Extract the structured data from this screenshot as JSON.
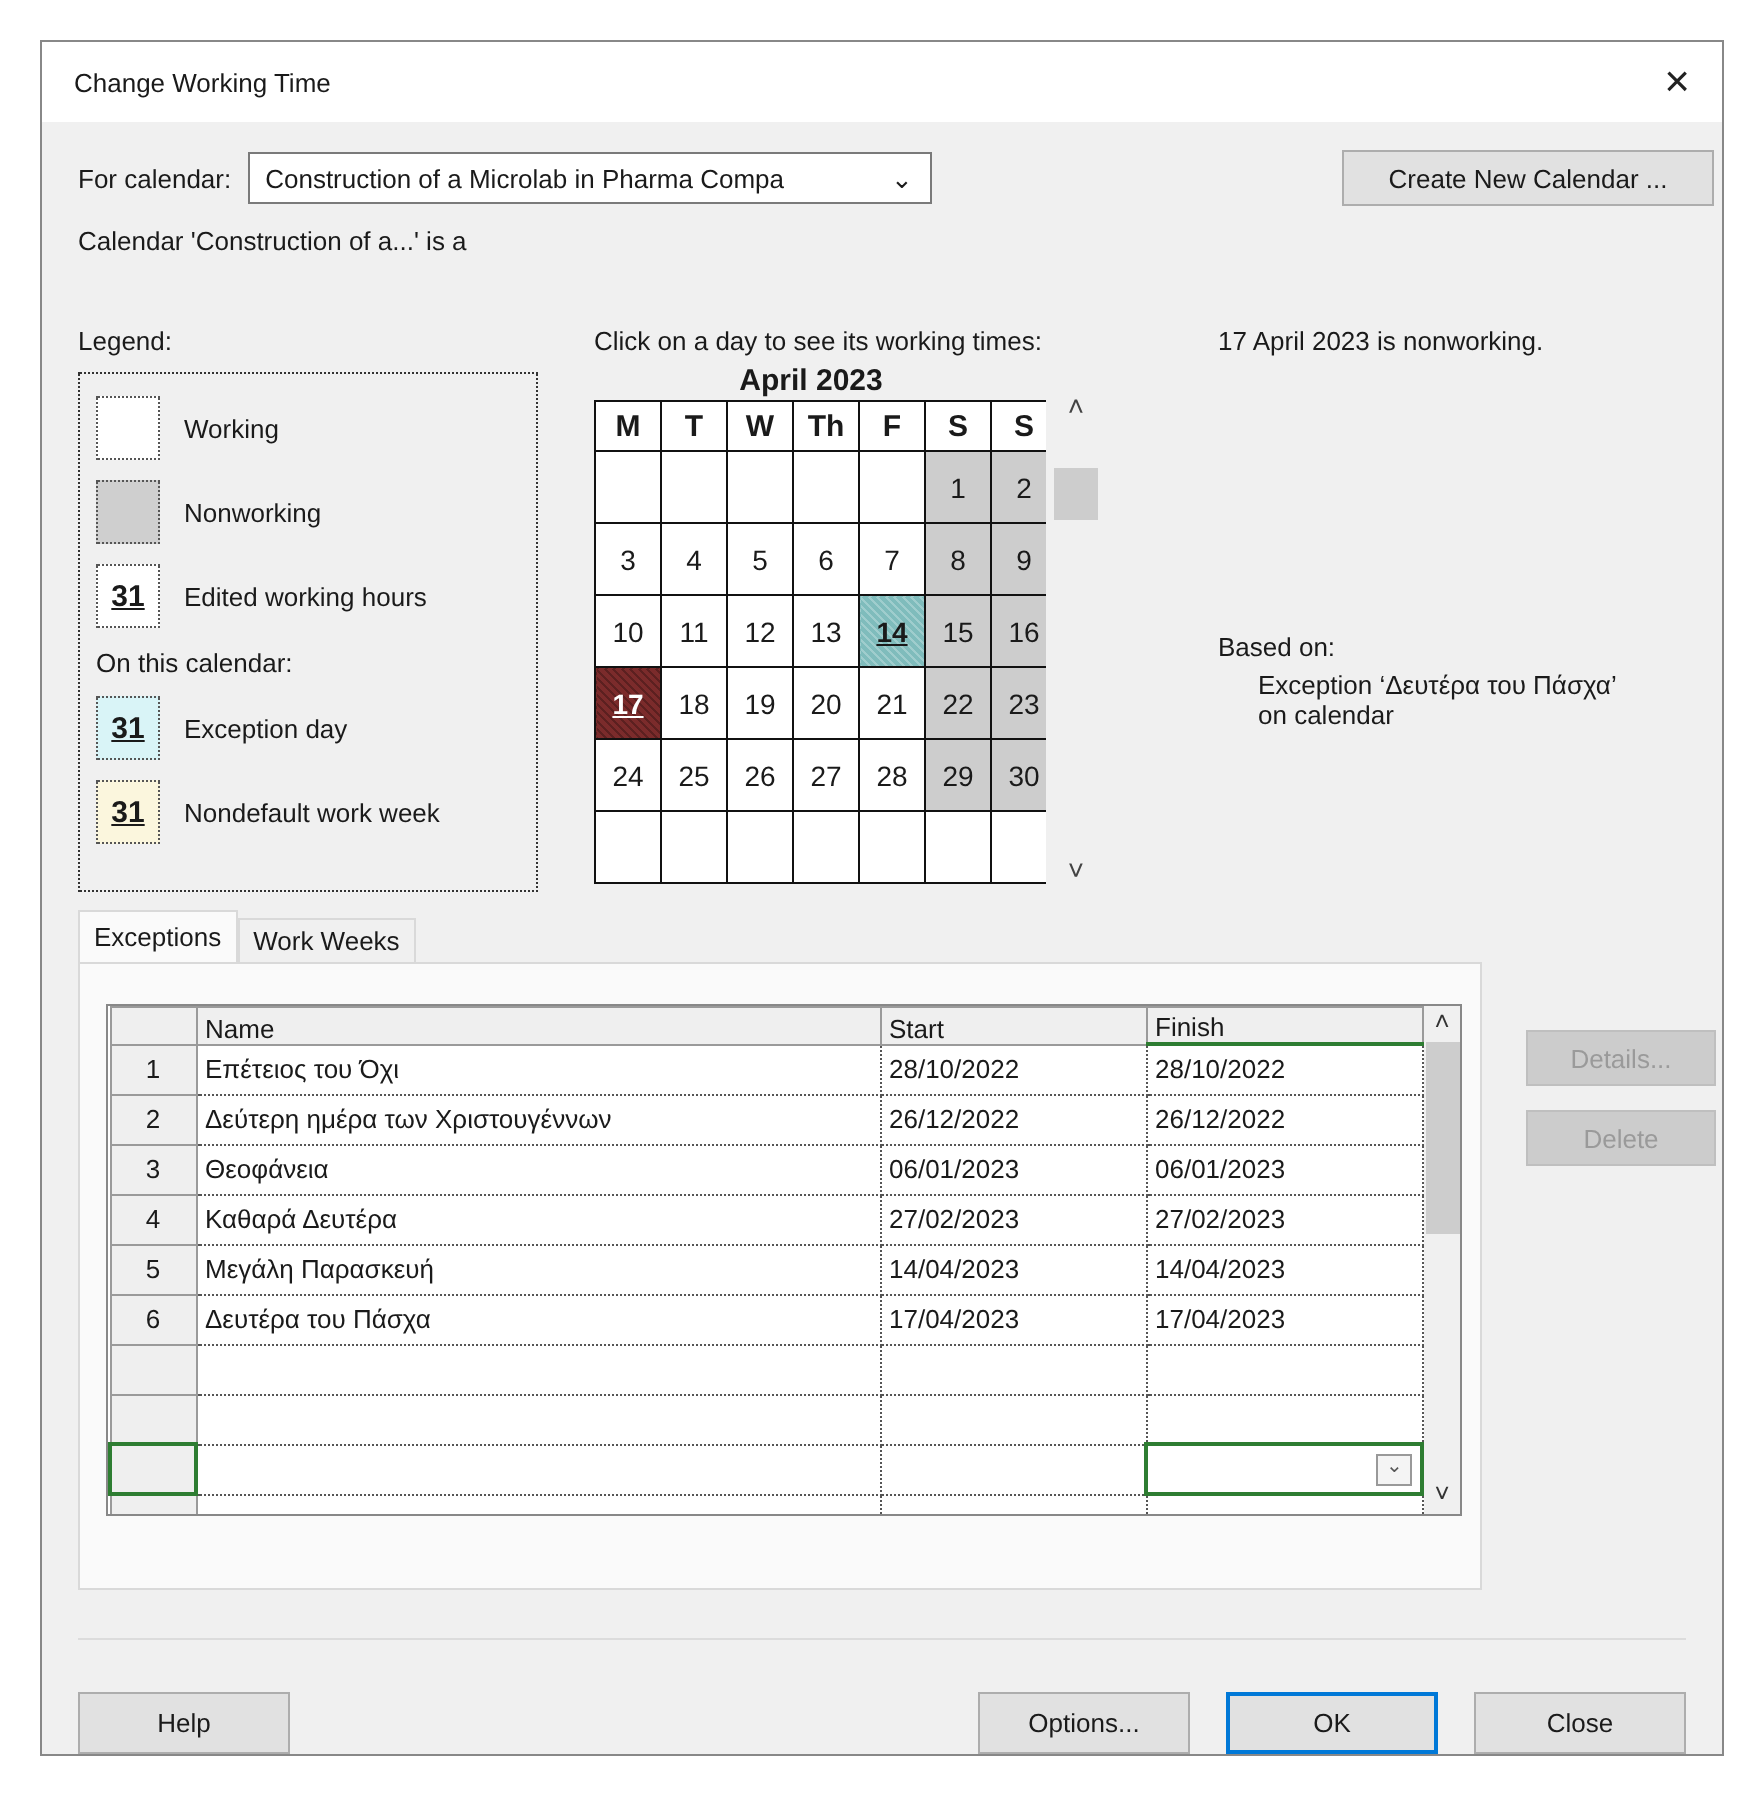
{
  "window": {
    "title": "Change Working Time",
    "close": "×"
  },
  "for_calendar": {
    "label": "For calendar:",
    "value": "Construction of a Microlab in Pharma Compa",
    "caret": "⌄"
  },
  "create_button": {
    "label": "Create New Calendar ..."
  },
  "calendar_note": "Calendar 'Construction of a...' is a",
  "legend": {
    "title": "Legend:",
    "items": [
      {
        "kind": "working",
        "label": "Working"
      },
      {
        "kind": "nonworking",
        "label": "Nonworking"
      },
      {
        "kind": "edited",
        "sample": "31",
        "label": "Edited working hours"
      }
    ],
    "calendar_heading": "On this calendar:",
    "calendar_items": [
      {
        "kind": "exception",
        "sample": "31",
        "label": "Exception day"
      },
      {
        "kind": "nondefault",
        "sample": "31",
        "label": "Nondefault work week"
      }
    ]
  },
  "calendar": {
    "prompt": "Click on a day to see its working times:",
    "month": "April 2023",
    "weekdays": [
      "M",
      "T",
      "W",
      "Th",
      "F",
      "S",
      "S"
    ],
    "up": "˄",
    "down": "˅",
    "weeks": [
      [
        {
          "kind": "blank"
        },
        {
          "kind": "blank"
        },
        {
          "kind": "blank"
        },
        {
          "kind": "blank"
        },
        {
          "kind": "blank"
        },
        {
          "day": "1",
          "kind": "nonworking",
          "selected": false
        },
        {
          "day": "2",
          "kind": "nonworking",
          "selected": false
        }
      ],
      [
        {
          "day": "3",
          "kind": "working",
          "selected": false
        },
        {
          "day": "4",
          "kind": "working",
          "selected": false
        },
        {
          "day": "5",
          "kind": "working",
          "selected": false
        },
        {
          "day": "6",
          "kind": "working",
          "selected": false
        },
        {
          "day": "7",
          "kind": "working",
          "selected": false
        },
        {
          "day": "8",
          "kind": "nonworking",
          "selected": false
        },
        {
          "day": "9",
          "kind": "nonworking",
          "selected": false
        }
      ],
      [
        {
          "day": "10",
          "kind": "working",
          "selected": false
        },
        {
          "day": "11",
          "kind": "working",
          "selected": false
        },
        {
          "day": "12",
          "kind": "working",
          "selected": false
        },
        {
          "day": "13",
          "kind": "working",
          "selected": false
        },
        {
          "day": "14",
          "kind": "exception",
          "selected": false
        },
        {
          "day": "15",
          "kind": "nonworking",
          "selected": false
        },
        {
          "day": "16",
          "kind": "nonworking",
          "selected": false
        }
      ],
      [
        {
          "day": "17",
          "kind": "exception",
          "selected": true
        },
        {
          "day": "18",
          "kind": "working",
          "selected": false
        },
        {
          "day": "19",
          "kind": "working",
          "selected": false
        },
        {
          "day": "20",
          "kind": "working",
          "selected": false
        },
        {
          "day": "21",
          "kind": "working",
          "selected": false
        },
        {
          "day": "22",
          "kind": "nonworking",
          "selected": false
        },
        {
          "day": "23",
          "kind": "nonworking",
          "selected": false
        }
      ],
      [
        {
          "day": "24",
          "kind": "working",
          "selected": false
        },
        {
          "day": "25",
          "kind": "working",
          "selected": false
        },
        {
          "day": "26",
          "kind": "working",
          "selected": false
        },
        {
          "day": "27",
          "kind": "working",
          "selected": false
        },
        {
          "day": "28",
          "kind": "working",
          "selected": false
        },
        {
          "day": "29",
          "kind": "nonworking",
          "selected": false
        },
        {
          "day": "30",
          "kind": "nonworking",
          "selected": false
        }
      ],
      [
        {
          "kind": "blank"
        },
        {
          "kind": "blank"
        },
        {
          "kind": "blank"
        },
        {
          "kind": "blank"
        },
        {
          "kind": "blank"
        },
        {
          "kind": "blank"
        },
        {
          "kind": "blank"
        }
      ]
    ]
  },
  "day_info": {
    "status": "17 April 2023 is nonworking.",
    "based_on_label": "Based on:",
    "based_on": "Exception ‘Δευτέρα του Πάσχα’ on calendar"
  },
  "tabs": [
    {
      "label": "Exceptions",
      "selected": true
    },
    {
      "label": "Work Weeks",
      "selected": false
    }
  ],
  "exceptions": {
    "columns": [
      "Name",
      "Start",
      "Finish"
    ],
    "up": "˄",
    "down": "˅",
    "rows": [
      {
        "number": "1",
        "name": "Επέτειος του Όχι",
        "start": "28/10/2022",
        "finish": "28/10/2022"
      },
      {
        "number": "2",
        "name": "Δεύτερη ημέρα των Χριστουγέννων",
        "start": "26/12/2022",
        "finish": "26/12/2022"
      },
      {
        "number": "3",
        "name": "Θεοφάνεια",
        "start": "06/01/2023",
        "finish": "06/01/2023"
      },
      {
        "number": "4",
        "name": "Καθαρά Δευτέρα",
        "start": "27/02/2023",
        "finish": "27/02/2023"
      },
      {
        "number": "5",
        "name": "Μεγάλη Παρασκευή",
        "start": "14/04/2023",
        "finish": "14/04/2023"
      },
      {
        "number": "6",
        "name": "Δευτέρα του Πάσχα",
        "start": "17/04/2023",
        "finish": "17/04/2023"
      }
    ]
  },
  "side_buttons": [
    {
      "label": "Details...",
      "disabled": true
    },
    {
      "label": "Delete",
      "disabled": true
    }
  ],
  "footer_buttons": [
    {
      "label": "Help",
      "default": false
    },
    {
      "label": "Options...",
      "default": false
    },
    {
      "label": "OK",
      "default": true
    },
    {
      "label": "Close",
      "default": false
    }
  ]
}
